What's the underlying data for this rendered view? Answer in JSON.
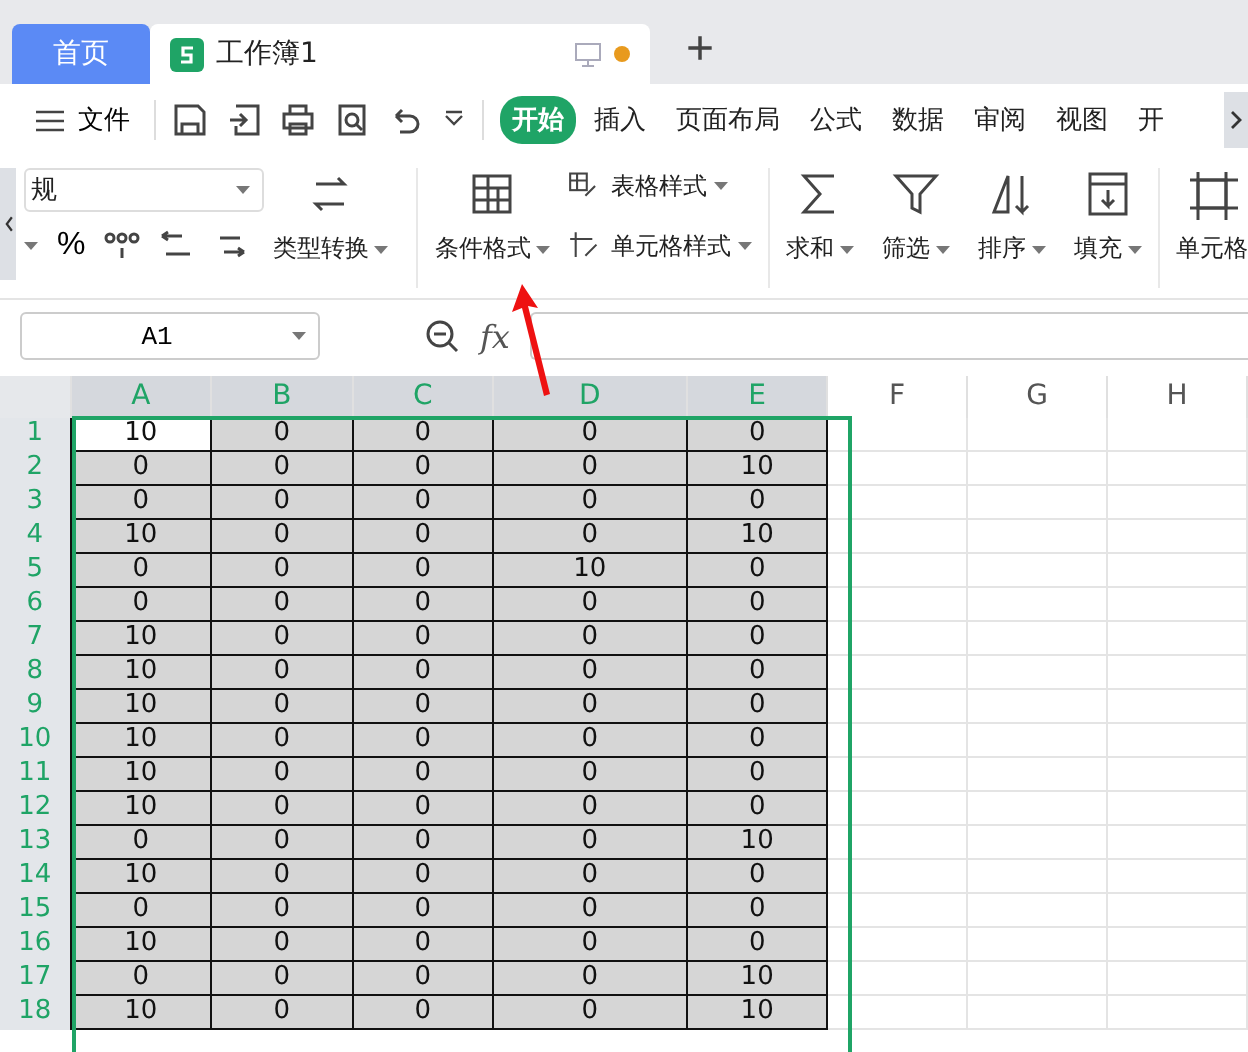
{
  "tabs": [
    {
      "label": "首页",
      "kind": "home",
      "selected": false
    },
    {
      "label": "工作簿1",
      "kind": "doc",
      "selected": true,
      "unsaved": true
    }
  ],
  "new_tab": "+",
  "menu": {
    "file": "文件",
    "tabs": [
      {
        "label": "开始",
        "selected": true
      },
      {
        "label": "插入",
        "selected": false
      },
      {
        "label": "页面布局",
        "selected": false
      },
      {
        "label": "公式",
        "selected": false
      },
      {
        "label": "数据",
        "selected": false
      },
      {
        "label": "审阅",
        "selected": false
      },
      {
        "label": "视图",
        "selected": false
      },
      {
        "label": "开",
        "selected": false
      }
    ]
  },
  "ribbon": {
    "number_format": "规",
    "percent": "%",
    "convert": "类型转换",
    "conditional_format": "条件格式",
    "table_style": "表格样式",
    "cell_style": "单元格样式",
    "sum": "求和",
    "filter": "筛选",
    "sort": "排序",
    "fill": "填充",
    "cell": "单元格"
  },
  "formula_bar": {
    "name_box": "A1",
    "fx": "fx"
  },
  "grid": {
    "columns": [
      {
        "label": "A",
        "selected": true
      },
      {
        "label": "B",
        "selected": true
      },
      {
        "label": "C",
        "selected": true
      },
      {
        "label": "D",
        "selected": true
      },
      {
        "label": "E",
        "selected": true
      },
      {
        "label": "F",
        "selected": false
      },
      {
        "label": "G",
        "selected": false
      },
      {
        "label": "H",
        "selected": false
      }
    ],
    "rows": [
      {
        "header": "1",
        "active_first": true,
        "cells": [
          "10",
          "0",
          "0",
          "0",
          "0"
        ]
      },
      {
        "header": "2",
        "active_first": false,
        "cells": [
          "0",
          "0",
          "0",
          "0",
          "10"
        ]
      },
      {
        "header": "3",
        "active_first": false,
        "cells": [
          "0",
          "0",
          "0",
          "0",
          "0"
        ]
      },
      {
        "header": "4",
        "active_first": false,
        "cells": [
          "10",
          "0",
          "0",
          "0",
          "10"
        ]
      },
      {
        "header": "5",
        "active_first": false,
        "cells": [
          "0",
          "0",
          "0",
          "10",
          "0"
        ]
      },
      {
        "header": "6",
        "active_first": false,
        "cells": [
          "0",
          "0",
          "0",
          "0",
          "0"
        ]
      },
      {
        "header": "7",
        "active_first": false,
        "cells": [
          "10",
          "0",
          "0",
          "0",
          "0"
        ]
      },
      {
        "header": "8",
        "active_first": false,
        "cells": [
          "10",
          "0",
          "0",
          "0",
          "0"
        ]
      },
      {
        "header": "9",
        "active_first": false,
        "cells": [
          "10",
          "0",
          "0",
          "0",
          "0"
        ]
      },
      {
        "header": "10",
        "active_first": false,
        "cells": [
          "10",
          "0",
          "0",
          "0",
          "0"
        ]
      },
      {
        "header": "11",
        "active_first": false,
        "cells": [
          "10",
          "0",
          "0",
          "0",
          "0"
        ]
      },
      {
        "header": "12",
        "active_first": false,
        "cells": [
          "10",
          "0",
          "0",
          "0",
          "0"
        ]
      },
      {
        "header": "13",
        "active_first": false,
        "cells": [
          "0",
          "0",
          "0",
          "0",
          "10"
        ]
      },
      {
        "header": "14",
        "active_first": false,
        "cells": [
          "10",
          "0",
          "0",
          "0",
          "0"
        ]
      },
      {
        "header": "15",
        "active_first": false,
        "cells": [
          "0",
          "0",
          "0",
          "0",
          "0"
        ]
      },
      {
        "header": "16",
        "active_first": false,
        "cells": [
          "10",
          "0",
          "0",
          "0",
          "0"
        ]
      },
      {
        "header": "17",
        "active_first": false,
        "cells": [
          "0",
          "0",
          "0",
          "0",
          "10"
        ]
      },
      {
        "header": "18",
        "active_first": false,
        "cells": [
          "10",
          "0",
          "0",
          "0",
          "10"
        ]
      }
    ]
  }
}
